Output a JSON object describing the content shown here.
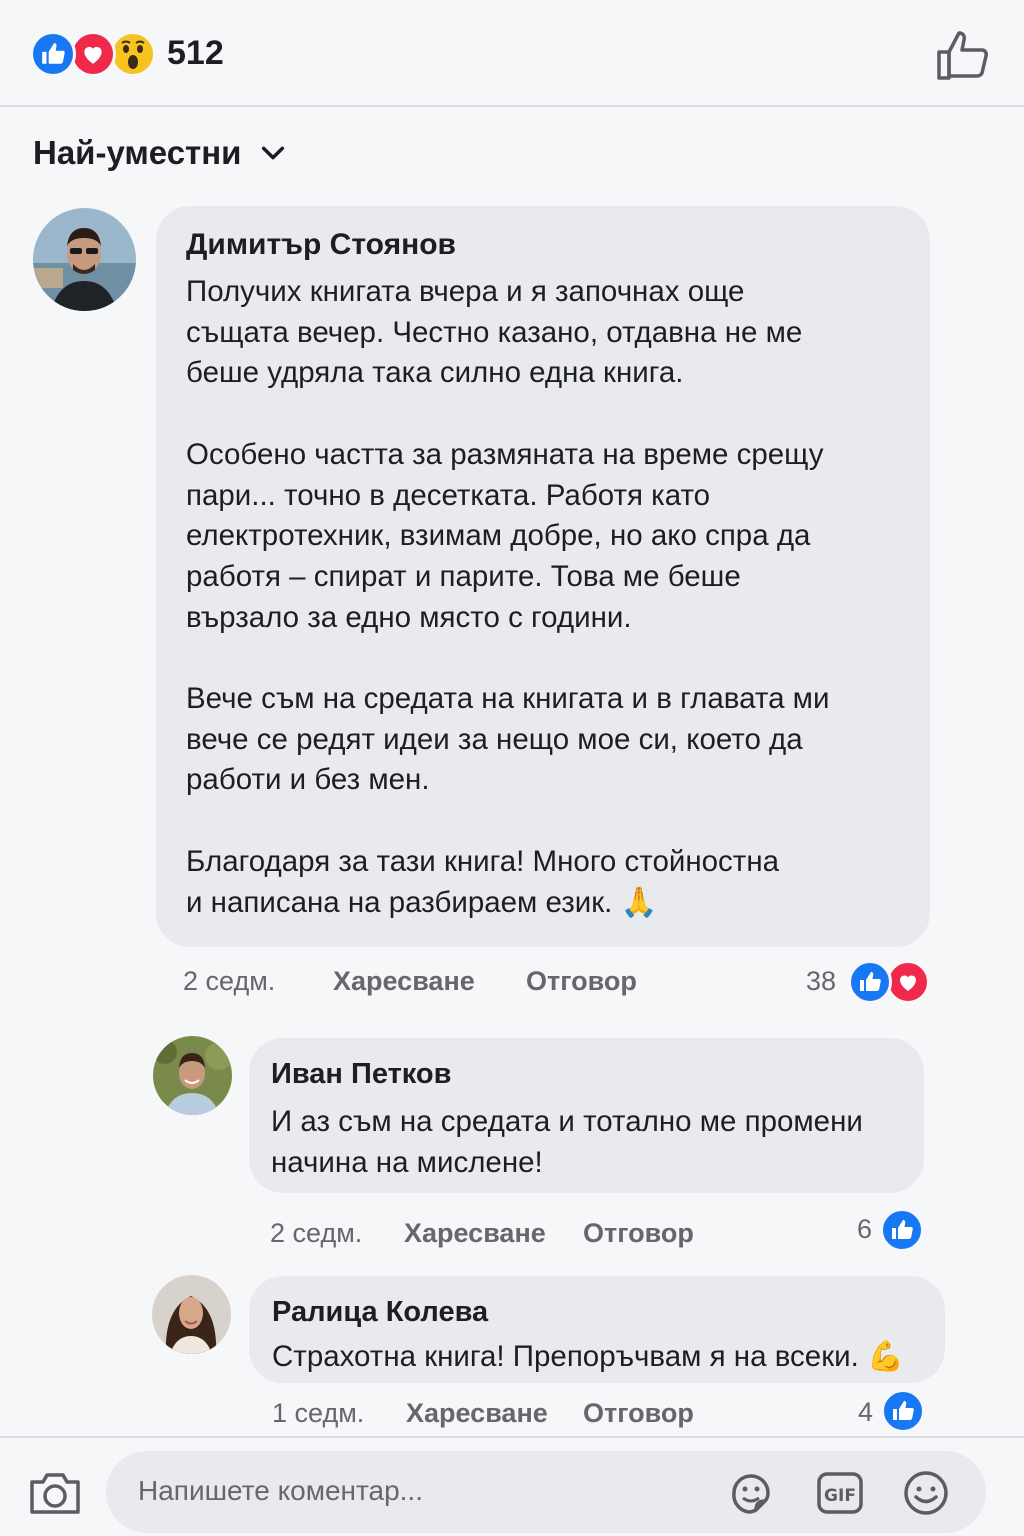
{
  "reactions": {
    "count": "512",
    "types": [
      "like-icon",
      "love-icon",
      "wow-icon"
    ]
  },
  "sort": {
    "label": "Най-уместни"
  },
  "comments": [
    {
      "author": "Димитър Стоянов",
      "text": "Получих книгата вчера и я започнах още\nсъщата вечер. Честно казано, отдавна не ме\nбеше удряла така силно една книга.\n\nОсобено частта за размяната на време срещу\nпари... точно в десетката. Работя като\nелектротехник, взимам добре, но ако спра да\nработя – спират и парите. Това ме беше\nвързало за едно място с години.\n\nВече съм на средата на книгата и в главата ми\nвече се редят идеи за нещо мое си, което да\nработи и без мен.\n\nБлагодаря за тази книга! Много стойностна\nи написана на разбираем език. 🙏",
      "time": "2 седм.",
      "like_label": "Харесване",
      "reply_label": "Отговор",
      "reaction_count": "38"
    },
    {
      "author": "Иван Петков",
      "text": "И аз съм на средата и тотално ме промени\nначина на мислене!",
      "time": "2 седм.",
      "like_label": "Харесване",
      "reply_label": "Отговор",
      "reaction_count": "6"
    },
    {
      "author": "Ралица Колева",
      "text": "Страхотна книга! Препоръчвам я на всеки. 💪",
      "time": "1 седм.",
      "like_label": "Харесване",
      "reply_label": "Отговор",
      "reaction_count": "4"
    }
  ],
  "composer": {
    "placeholder": "Напишете коментар...",
    "icons": [
      "camera-icon",
      "sticker-icon",
      "gif-icon",
      "emoji-icon"
    ]
  },
  "colors": {
    "like": "#1877f2",
    "love": "#f02849",
    "wow": "#f7c31f",
    "bubble": "#e9eaee",
    "meta": "#65676b"
  }
}
